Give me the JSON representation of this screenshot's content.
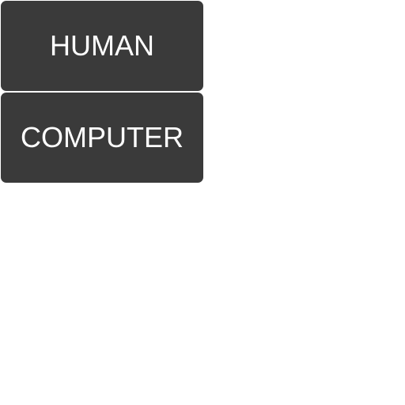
{
  "menu": {
    "buttons": [
      {
        "label": "HUMAN"
      },
      {
        "label": "COMPUTER"
      }
    ]
  },
  "colors": {
    "button_bg": "#3a3a3a",
    "button_text": "#ffffff",
    "background": "#ffffff"
  }
}
